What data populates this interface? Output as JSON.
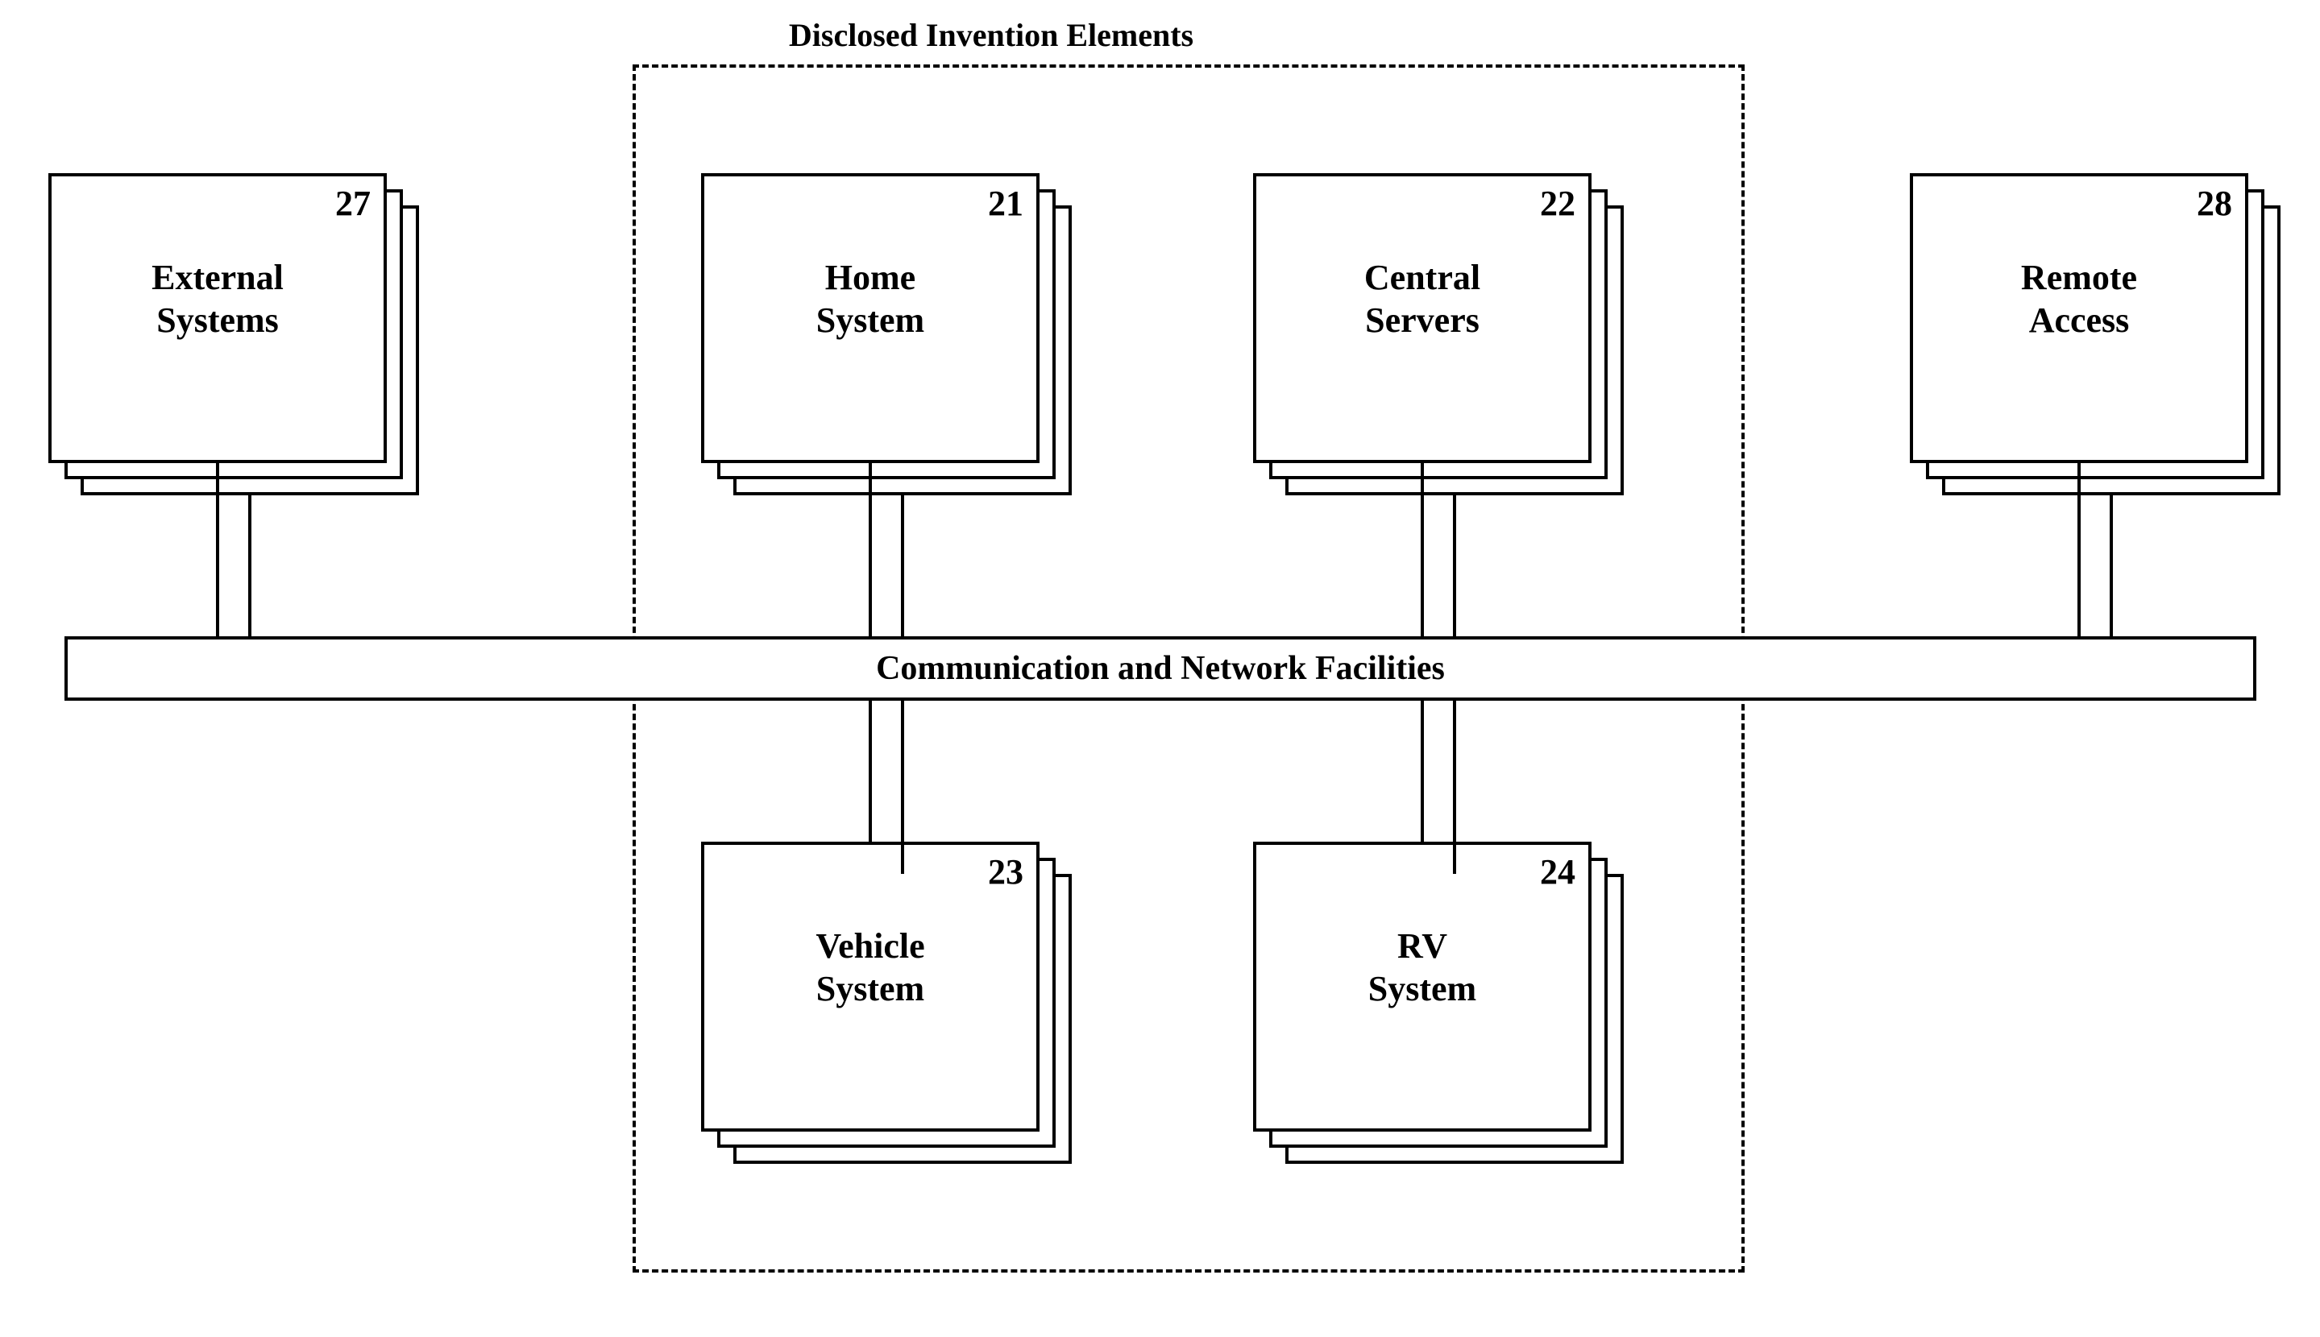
{
  "title": "Disclosed Invention Elements",
  "boxes": {
    "external_systems": {
      "num": "27",
      "line1": "External",
      "line2": "Systems"
    },
    "home_system": {
      "num": "21",
      "line1": "Home",
      "line2": "System"
    },
    "central_servers": {
      "num": "22",
      "line1": "Central",
      "line2": "Servers"
    },
    "remote_access": {
      "num": "28",
      "line1": "Remote",
      "line2": "Access"
    },
    "vehicle_system": {
      "num": "23",
      "line1": "Vehicle",
      "line2": "System"
    },
    "rv_system": {
      "num": "24",
      "line1": "RV",
      "line2": "System"
    }
  },
  "bus_label": "Communication and Network Facilities"
}
